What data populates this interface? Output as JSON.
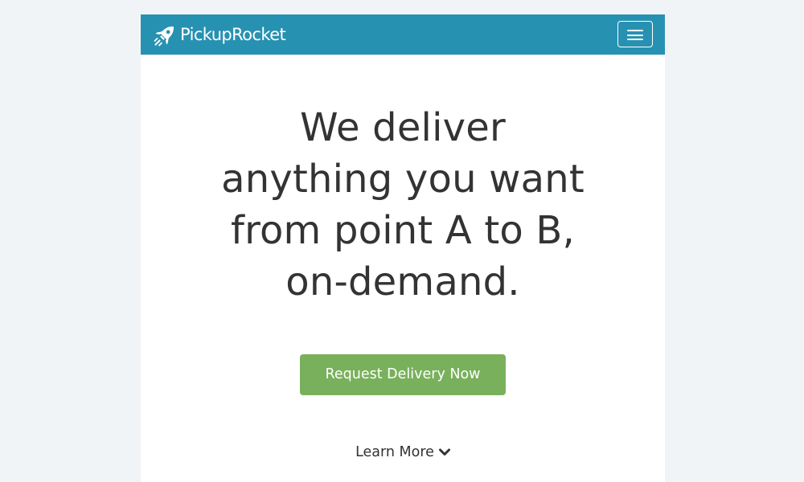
{
  "navbar": {
    "brand_name": "PickupRocket",
    "logo_icon": "rocket-icon",
    "menu_icon": "hamburger-menu-icon",
    "background_color": "#2791b2"
  },
  "hero": {
    "headline_lines": [
      "We deliver",
      "anything you want",
      "from point A to B,",
      "on-demand."
    ],
    "cta_label": "Request Delivery Now",
    "cta_color": "#79b05c",
    "learn_more_label": "Learn More",
    "learn_more_icon": "chevron-down-icon"
  }
}
